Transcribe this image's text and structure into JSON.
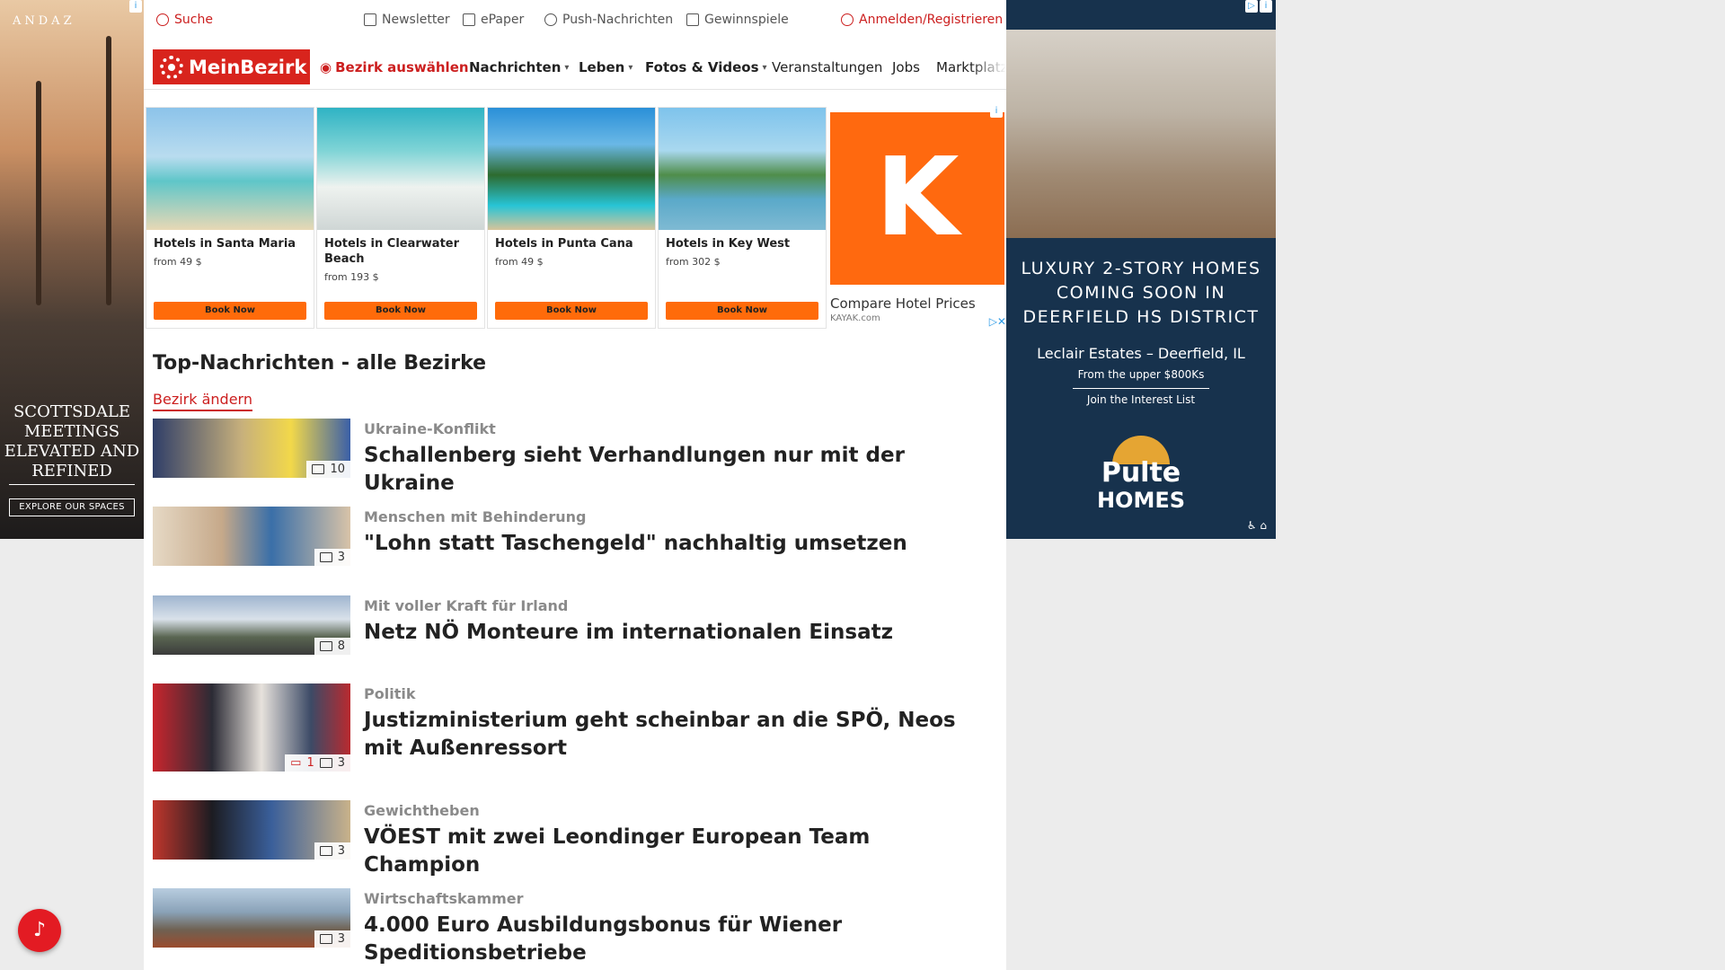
{
  "left_ad": {
    "brand": "ANDAZ",
    "headline_lines": [
      "SCOTTSDALE",
      "MEETINGS",
      "ELEVATED AND",
      "REFINED"
    ],
    "cta": "EXPLORE OUR SPACES"
  },
  "topbar": {
    "search": "Suche",
    "newsletter": "Newsletter",
    "epaper": "ePaper",
    "push": "Push-Nachrichten",
    "gewinnspiele": "Gewinnspiele",
    "login": "Anmelden/Registrieren"
  },
  "nav": {
    "logo": "MeinBezirk",
    "bezirk": "Bezirk auswählen",
    "items": [
      "Nachrichten",
      "Leben",
      "Fotos & Videos",
      "Veranstaltungen",
      "Jobs",
      "Marktplatz"
    ]
  },
  "hotel_ad": {
    "cards": [
      {
        "name": "Hotels in Santa Maria",
        "price": "from 49 $",
        "button": "Book Now"
      },
      {
        "name": "Hotels in Clearwater Beach",
        "price": "from 193 $",
        "button": "Book Now"
      },
      {
        "name": "Hotels in Punta Cana",
        "price": "from 49 $",
        "button": "Book Now"
      },
      {
        "name": "Hotels in Key West",
        "price": "from 302 $",
        "button": "Book Now"
      }
    ],
    "kayak_letter": "K",
    "kayak_caption": "Compare Hotel Prices",
    "kayak_source": "KAYAK.com"
  },
  "section": {
    "title": "Top-Nachrichten - alle Bezirke",
    "change": "Bezirk ändern"
  },
  "articles": [
    {
      "kicker": "Ukraine-Konflikt",
      "title": "Schallenberg sieht Verhandlungen nur mit der Ukraine",
      "photos": "10",
      "comments": ""
    },
    {
      "kicker": "Menschen mit Behinderung",
      "title": "\"Lohn statt Taschengeld\" nachhaltig umsetzen",
      "photos": "3",
      "comments": ""
    },
    {
      "kicker": "Mit voller Kraft für Irland",
      "title": "Netz NÖ Monteure im internationalen Einsatz",
      "photos": "8",
      "comments": ""
    },
    {
      "kicker": "Politik",
      "title": "Justizministerium geht scheinbar an die SPÖ, Neos mit Außenressort",
      "photos": "3",
      "comments": "1"
    },
    {
      "kicker": "Gewichtheben",
      "title": "VÖEST mit zwei Leondinger European Team Champion",
      "photos": "3",
      "comments": ""
    },
    {
      "kicker": "Wirtschaftskammer",
      "title": "4.000 Euro Ausbildungsbonus für Wiener Speditionsbetriebe",
      "photos": "3",
      "comments": ""
    }
  ],
  "right_ad": {
    "headline_lines": [
      "LUXURY 2-STORY HOMES",
      "COMING SOON IN",
      "DEERFIELD HS DISTRICT"
    ],
    "location": "Leclair Estates – Deerfield, IL",
    "price": "From the upper $800Ks",
    "cta": "Join the Interest List",
    "brand_top": "Pulte",
    "brand_bottom": "HOMES"
  },
  "colors": {
    "brand_red": "#d8241d",
    "kayak_orange": "#ff690f",
    "book_orange": "#ff6b0a",
    "pulte_navy": "#17324d"
  }
}
